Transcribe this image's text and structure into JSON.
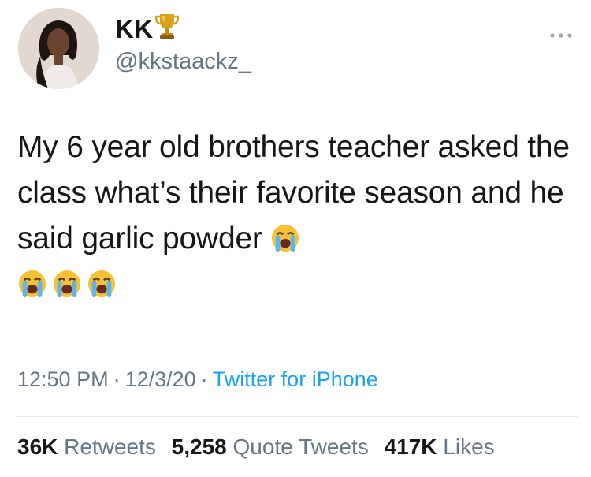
{
  "user": {
    "display_name": "KK",
    "badge_icon": "trophy-icon",
    "handle": "@kkstaackz_"
  },
  "tweet": {
    "text": "My 6 year old brothers teacher asked the class what’s their favorite season and he said garlic powder",
    "emoji_icon": "loudly-crying-face-icon",
    "emoji_count": 4
  },
  "meta": {
    "time": "12:50 PM",
    "date": "12/3/20",
    "separator": "·",
    "source": "Twitter for iPhone"
  },
  "stats": {
    "retweets_count": "36K",
    "retweets_label": "Retweets",
    "quotes_count": "5,258",
    "quotes_label": "Quote Tweets",
    "likes_count": "417K",
    "likes_label": "Likes"
  },
  "colors": {
    "accent": "#1da1f2",
    "secondary_text": "#657786",
    "primary_text": "#14171a"
  }
}
